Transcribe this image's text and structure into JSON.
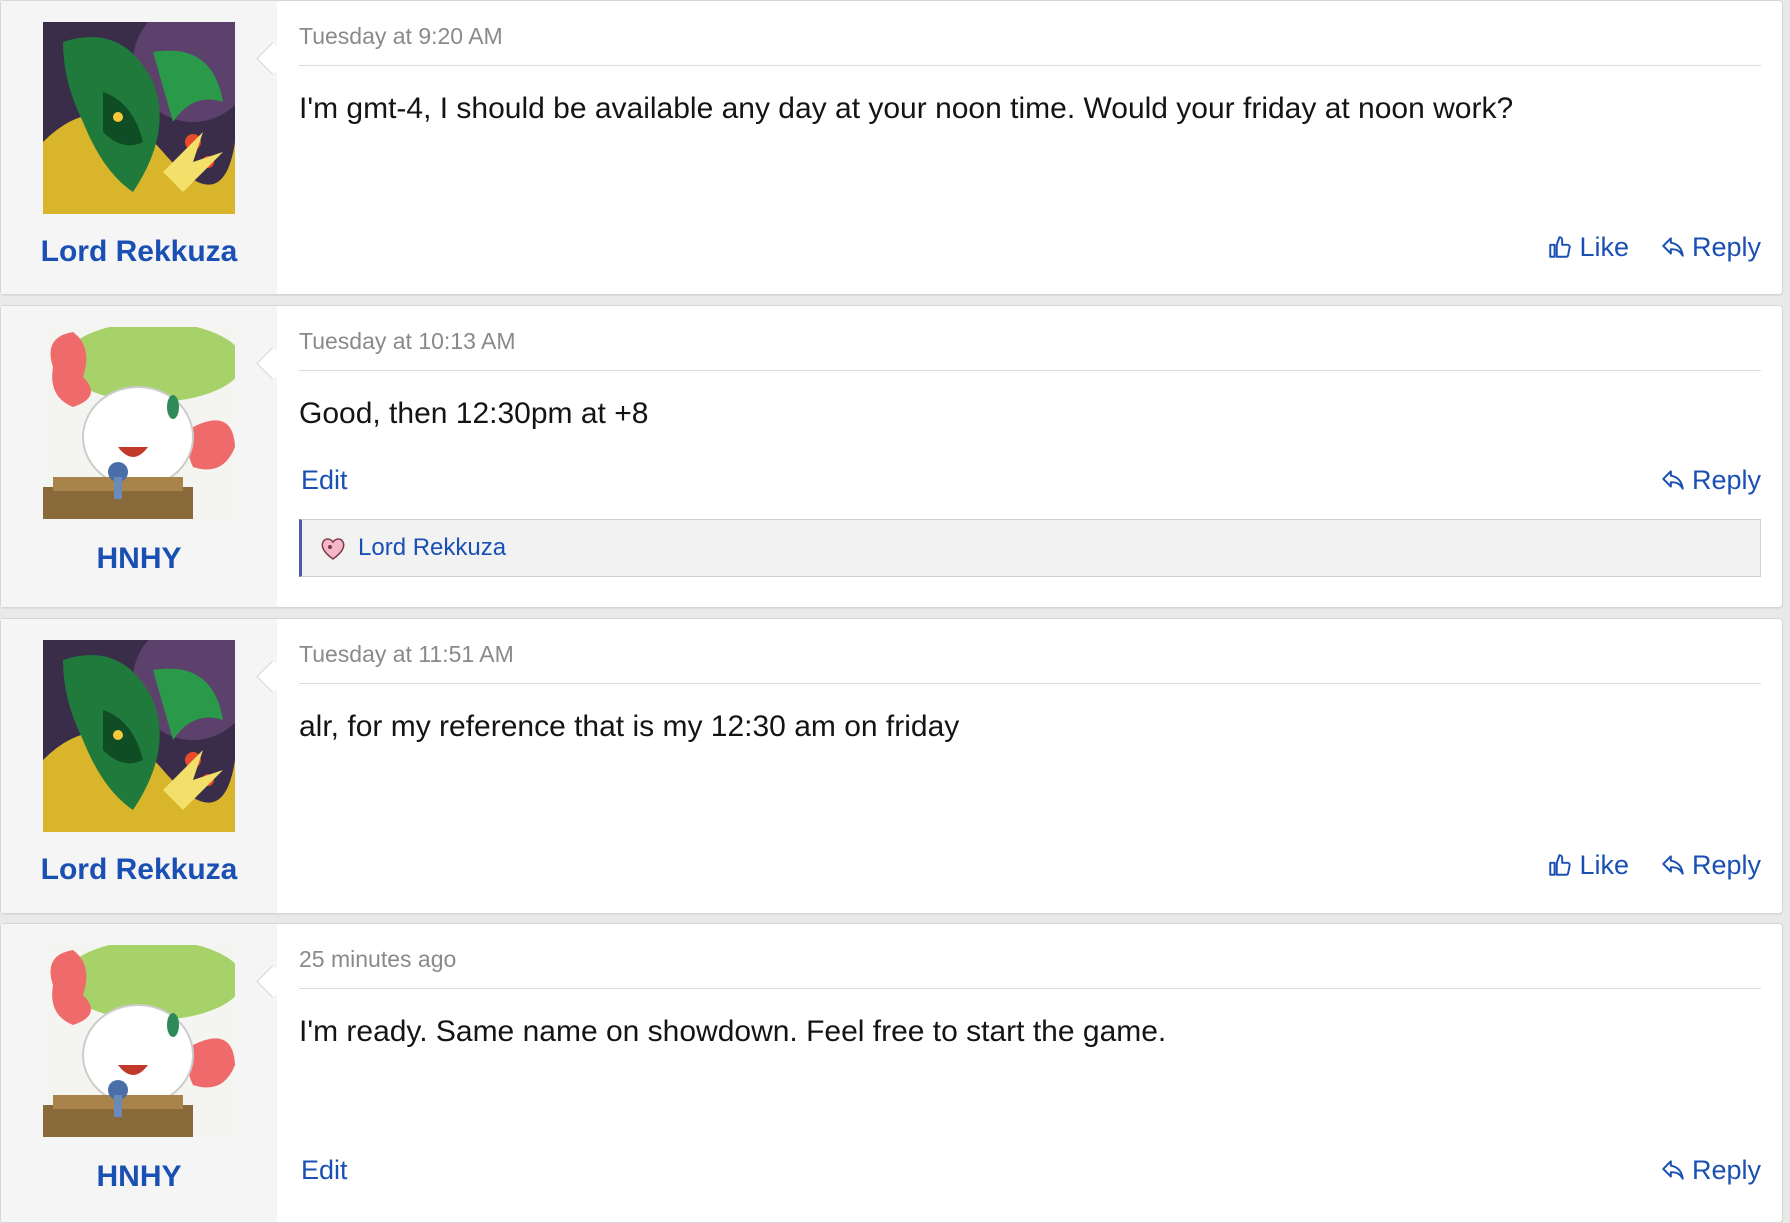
{
  "colors": {
    "link": "#1a4fb4",
    "meta": "#8a8a8a",
    "user_panel": "#f5f5f5",
    "reaction_bar_accent": "#4a5aa8"
  },
  "posts": [
    {
      "author": "Lord Rekkuza",
      "avatar_icon": "rayquaza-avatar",
      "timestamp": "Tuesday at 9:20 AM",
      "message": "I'm gmt-4, I should be available any day at your noon time. Would your friday at noon work?",
      "actions": {
        "like": "Like",
        "reply": "Reply"
      }
    },
    {
      "author": "HNHY",
      "avatar_icon": "shaymin-avatar",
      "timestamp": "Tuesday at 10:13 AM",
      "message": "Good, then 12:30pm at +8",
      "actions": {
        "edit": "Edit",
        "reply": "Reply"
      },
      "reaction": {
        "icon": "heart-reaction-icon",
        "users": "Lord Rekkuza"
      }
    },
    {
      "author": "Lord Rekkuza",
      "avatar_icon": "rayquaza-avatar",
      "timestamp": "Tuesday at 11:51 AM",
      "message": "alr, for my reference that is my 12:30 am on friday",
      "actions": {
        "like": "Like",
        "reply": "Reply"
      }
    },
    {
      "author": "HNHY",
      "avatar_icon": "shaymin-avatar",
      "timestamp": "25 minutes ago",
      "message": "I'm ready. Same name on showdown. Feel free to start the game.",
      "actions": {
        "edit": "Edit",
        "reply": "Reply"
      }
    }
  ]
}
